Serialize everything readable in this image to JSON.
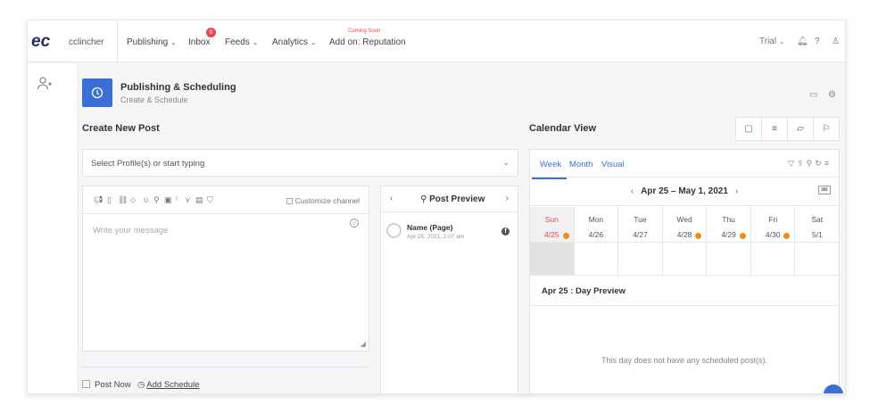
{
  "nav": {
    "brand": "cclincher",
    "items": [
      {
        "label": "Publishing",
        "chevron": true
      },
      {
        "label": "Inbox",
        "chevron": false
      },
      {
        "label": "Feeds",
        "chevron": true
      },
      {
        "label": "Analytics",
        "chevron": true
      },
      {
        "label": "Add on: Reputation",
        "chevron": false
      }
    ],
    "inbox_badge": "0",
    "coming_soon": "Coming Soon",
    "trial": "Trial"
  },
  "header": {
    "title": "Publishing & Scheduling",
    "subtitle": "Create & Schedule"
  },
  "create_post": {
    "title": "Create New Post",
    "profile_placeholder": "Select Profile(s) or start typing",
    "customize_channel": "Customize channel",
    "message_placeholder": "Write your message",
    "post_now": "Post Now",
    "add_schedule": "Add Schedule"
  },
  "preview": {
    "title": "Post Preview",
    "name": "Name (Page)",
    "date": "Apr 25, 2021, 2:07 am"
  },
  "calendar": {
    "title": "Calendar View",
    "tabs": [
      "Week",
      "Month",
      "Visual"
    ],
    "range": "Apr 25 – May 1, 2021",
    "kb_label": "kbd",
    "days": [
      {
        "name": "Sun",
        "date": "4/25",
        "dot": true,
        "today": true
      },
      {
        "name": "Mon",
        "date": "4/26",
        "dot": false,
        "today": false
      },
      {
        "name": "Tue",
        "date": "4/27",
        "dot": false,
        "today": false
      },
      {
        "name": "Wed",
        "date": "4/28",
        "dot": true,
        "today": false
      },
      {
        "name": "Thu",
        "date": "4/29",
        "dot": true,
        "today": false
      },
      {
        "name": "Fri",
        "date": "4/30",
        "dot": true,
        "today": false
      },
      {
        "name": "Sat",
        "date": "5/1",
        "dot": false,
        "today": false
      }
    ],
    "day_preview": "Apr 25 : Day Preview",
    "empty_message": "This day does not have any scheduled post(s)."
  },
  "colors": {
    "accent": "#3b6fd6",
    "today": "#e5484d",
    "dot": "#f08c1a"
  }
}
